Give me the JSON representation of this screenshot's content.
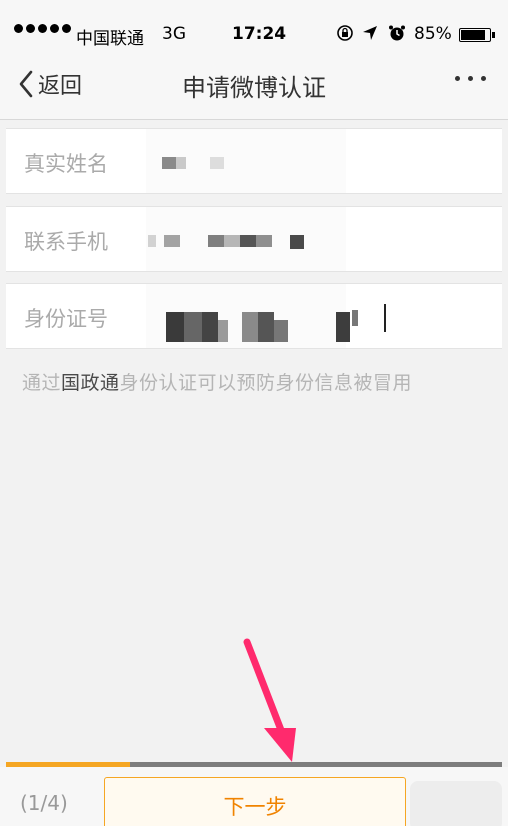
{
  "status_bar": {
    "carrier": "中国联通",
    "network": "3G",
    "time": "17:24",
    "battery_percent": "85%",
    "battery_level": 0.85,
    "icons": [
      "signal-dots-icon",
      "rotation-lock-icon",
      "location-icon",
      "alarm-icon",
      "battery-icon"
    ]
  },
  "nav": {
    "back_label": "返回",
    "title": "申请微博认证",
    "more_icon": "more-dots-icon"
  },
  "form": {
    "fields": [
      {
        "label": "真实姓名",
        "value_state": "pixelated"
      },
      {
        "label": "联系手机",
        "value_state": "pixelated"
      },
      {
        "label": "身份证号",
        "value_state": "pixelated"
      }
    ]
  },
  "hint": {
    "prefix": "通过",
    "highlight": "国政通",
    "suffix": "身份认证可以预防身份信息被冒用"
  },
  "progress": {
    "step_label": "(1/4)",
    "fraction": 0.25
  },
  "actions": {
    "next_label": "下一步"
  },
  "colors": {
    "accent": "#f5a623",
    "button_text": "#f08300",
    "annotation_arrow": "#ff2a6d"
  }
}
